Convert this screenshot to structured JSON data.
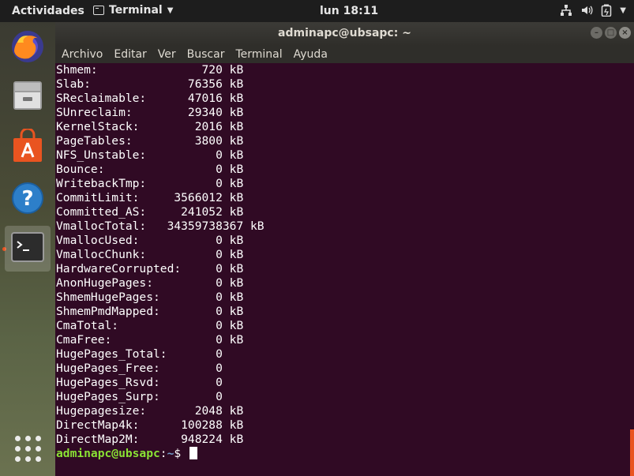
{
  "topbar": {
    "activities": "Actividades",
    "app_name": "Terminal",
    "clock": "lun 18:11"
  },
  "dock": {
    "items": [
      "firefox",
      "files",
      "software",
      "help",
      "terminal"
    ]
  },
  "window": {
    "title": "adminapc@ubsapc: ~",
    "menu": [
      "Archivo",
      "Editar",
      "Ver",
      "Buscar",
      "Terminal",
      "Ayuda"
    ]
  },
  "terminal": {
    "lines": [
      "Shmem:               720 kB",
      "Slab:              76356 kB",
      "SReclaimable:      47016 kB",
      "SUnreclaim:        29340 kB",
      "KernelStack:        2016 kB",
      "PageTables:         3800 kB",
      "NFS_Unstable:          0 kB",
      "Bounce:                0 kB",
      "WritebackTmp:          0 kB",
      "CommitLimit:     3566012 kB",
      "Committed_AS:     241052 kB",
      "VmallocTotal:   34359738367 kB",
      "VmallocUsed:           0 kB",
      "VmallocChunk:          0 kB",
      "HardwareCorrupted:     0 kB",
      "AnonHugePages:         0 kB",
      "ShmemHugePages:        0 kB",
      "ShmemPmdMapped:        0 kB",
      "CmaTotal:              0 kB",
      "CmaFree:               0 kB",
      "HugePages_Total:       0",
      "HugePages_Free:        0",
      "HugePages_Rsvd:        0",
      "HugePages_Surp:        0",
      "Hugepagesize:       2048 kB",
      "DirectMap4k:      100288 kB",
      "DirectMap2M:      948224 kB"
    ],
    "prompt_user": "adminapc@ubsapc",
    "prompt_sep": ":",
    "prompt_path": "~",
    "prompt_symbol": "$ "
  },
  "colors": {
    "terminal_bg": "#300a24",
    "prompt_user": "#8ae234",
    "prompt_path": "#729fcf",
    "accent": "#e95420"
  }
}
